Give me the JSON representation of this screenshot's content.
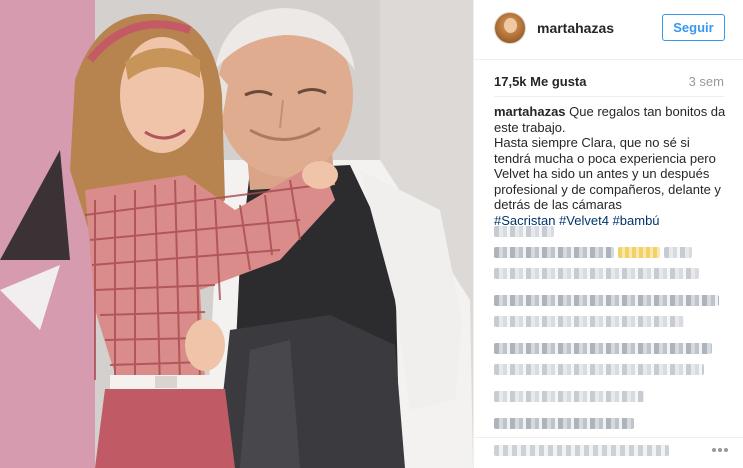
{
  "post": {
    "username": "martahazas",
    "follow_label": "Seguir",
    "likes": "17,5k Me gusta",
    "time_ago": "3 sem",
    "caption": {
      "user": "martahazas",
      "text_line1": " Que regalos tan bonitos da este trabajo.",
      "text_line2": "Hasta siempre Clara, que no sé si tendrá mucha o poca experiencia pero Velvet ha sido un antes y un después profesional y de compañeros, delante y detrás de las cámaras",
      "hashtags": [
        "#Sacristan",
        "#Velvet4",
        "#bambú"
      ]
    }
  },
  "colors": {
    "accent": "#3897f0",
    "hashtag": "#003569",
    "text": "#262626",
    "muted": "#999999"
  },
  "icons": {
    "avatar": "profile-avatar",
    "more": "more-dots-icon"
  }
}
